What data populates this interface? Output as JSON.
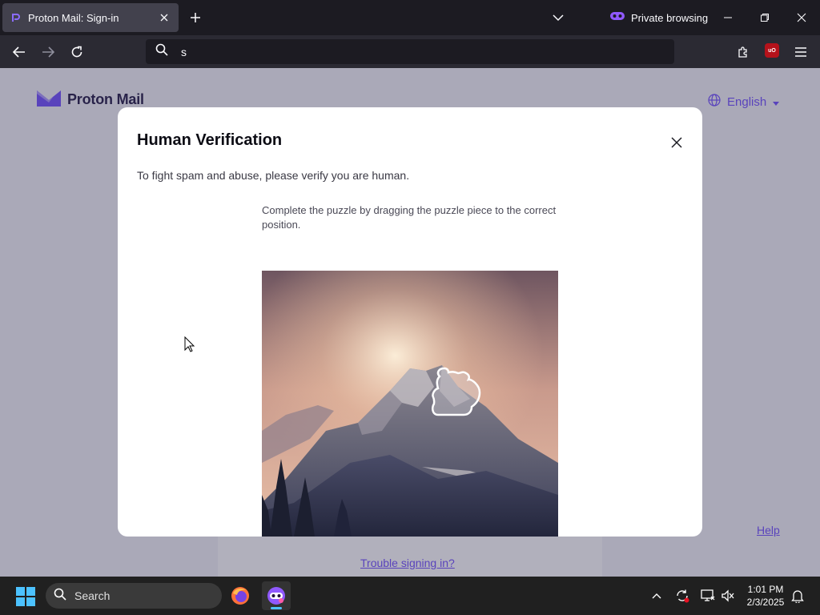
{
  "browser": {
    "tab_title": "Proton Mail: Sign-in",
    "private_label": "Private browsing",
    "url_text": "s"
  },
  "page": {
    "logo_text": "Proton Mail",
    "language": "English",
    "trouble_link": "Trouble signing in?",
    "help_link": "Help"
  },
  "modal": {
    "title": "Human Verification",
    "subtitle": "To fight spam and abuse, please verify you are human.",
    "instruction": "Complete the puzzle by dragging the puzzle piece to the correct position."
  },
  "taskbar": {
    "search_placeholder": "Search",
    "time": "1:01 PM",
    "date": "2/3/2025"
  },
  "colors": {
    "accent": "#6d4aff",
    "browser_bg": "#1c1b22",
    "toolbar_bg": "#2b2a33",
    "taskbar_bg": "#202020"
  }
}
